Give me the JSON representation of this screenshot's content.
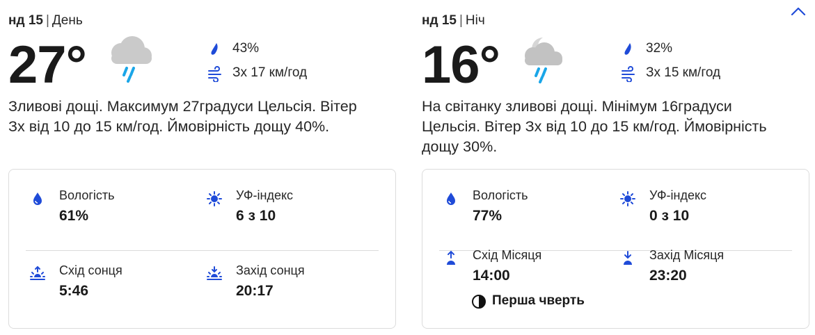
{
  "colors": {
    "accent": "#1f4bd8",
    "text": "#262626",
    "cloud": "#c8c8c8",
    "rain": "#1aa6e8"
  },
  "collapse_icon": "chevron-up-icon",
  "day": {
    "date": "нд 15",
    "separator": "|",
    "period": "День",
    "temperature": "27°",
    "condition_icon": "rain-cloud-icon",
    "precip_chance": "43%",
    "wind": "Зх 17 км/год",
    "summary": "Зливові дощі. Максимум 27градуси Цельсія. Вітер Зх від 10 до 15 км/год. Ймовірність дощу 40%.",
    "details": {
      "humidity": {
        "label": "Вологість",
        "value": "61%",
        "icon": "droplet-icon"
      },
      "uv": {
        "label": "УФ-індекс",
        "value": "6 з 10",
        "icon": "sun-icon"
      },
      "sunrise": {
        "label": "Схід сонця",
        "value": "5:46",
        "icon": "sunrise-icon"
      },
      "sunset": {
        "label": "Захід сонця",
        "value": "20:17",
        "icon": "sunset-icon"
      }
    }
  },
  "night": {
    "date": "нд 15",
    "separator": "|",
    "period": "Ніч",
    "temperature": "16°",
    "condition_icon": "moon-rain-cloud-icon",
    "precip_chance": "32%",
    "wind": "Зх 15 км/год",
    "summary": "На світанку зливові дощі. Мінімум 16градуси Цельсія. Вітер Зх від 10 до 15 км/год. Ймовірність дощу 30%.",
    "details": {
      "humidity": {
        "label": "Вологість",
        "value": "77%",
        "icon": "droplet-icon"
      },
      "uv": {
        "label": "УФ-індекс",
        "value": "0 з 10",
        "icon": "sun-icon"
      },
      "moonrise": {
        "label": "Схід Місяця",
        "value": "14:00",
        "icon": "moonrise-icon"
      },
      "moonset": {
        "label": "Захід Місяця",
        "value": "23:20",
        "icon": "moonset-icon"
      },
      "moon_phase": {
        "label": "Перша чверть",
        "icon": "half-moon-icon"
      }
    }
  }
}
